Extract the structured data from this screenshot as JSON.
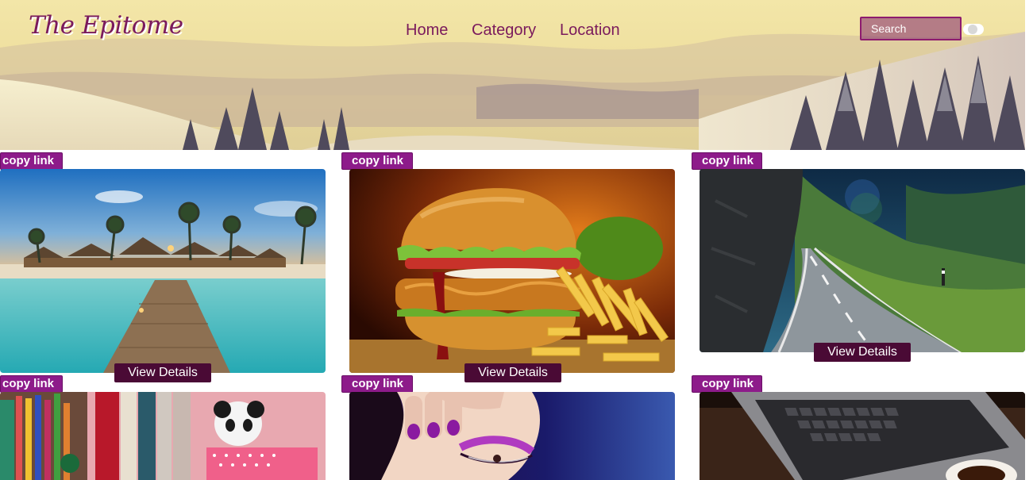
{
  "header": {
    "brand": "The Epitome",
    "nav": [
      "Home",
      "Category",
      "Location"
    ],
    "search_placeholder": "Search"
  },
  "cards": [
    {
      "copy_label": "copy link",
      "details_label": "View Details",
      "image": "beach-resort-pier"
    },
    {
      "copy_label": "copy link",
      "details_label": "View Details",
      "image": "burger-and-fries"
    },
    {
      "copy_label": "copy link",
      "details_label": "View Details",
      "image": "mountain-road"
    },
    {
      "copy_label": "copy link",
      "image": "desk-books-panda"
    },
    {
      "copy_label": "copy link",
      "image": "purple-makeup-face"
    },
    {
      "copy_label": "copy link",
      "image": "laptop-keyboard-coffee"
    }
  ],
  "colors": {
    "brand": "#7a1a5c",
    "accent": "#8d1b8a",
    "button": "#4a0a35"
  }
}
